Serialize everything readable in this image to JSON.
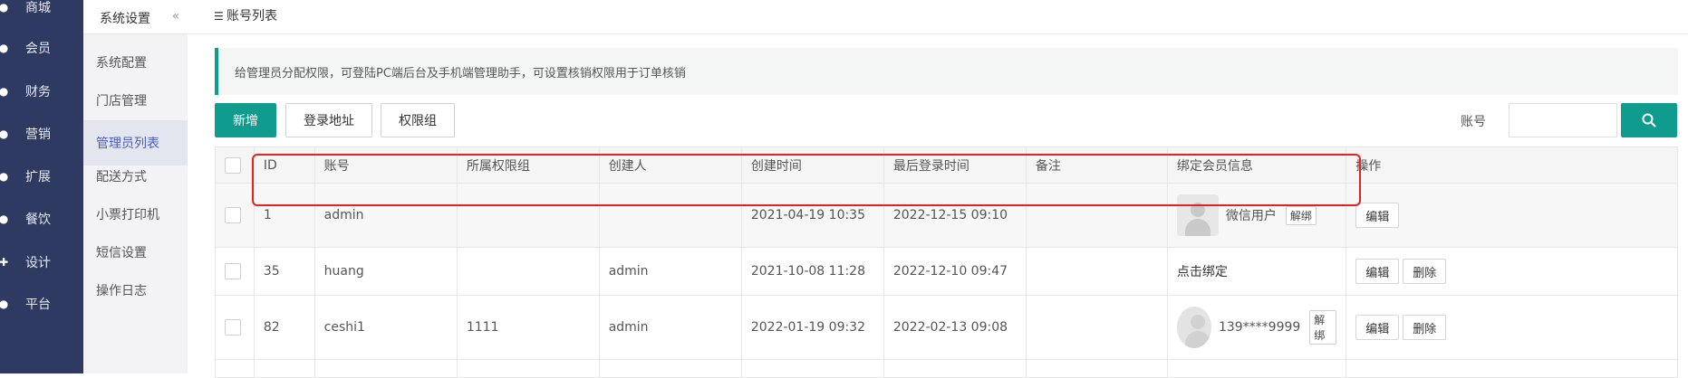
{
  "nav": {
    "items": [
      {
        "label": "商城"
      },
      {
        "label": "会员"
      },
      {
        "label": "财务"
      },
      {
        "label": "营销"
      },
      {
        "label": "扩展"
      },
      {
        "label": "餐饮"
      },
      {
        "label": "设计"
      },
      {
        "label": "平台"
      }
    ]
  },
  "subnav": {
    "title": "系统设置",
    "collapse": "«",
    "items": [
      {
        "label": "系统配置"
      },
      {
        "label": "门店管理"
      },
      {
        "label": "管理员列表"
      },
      {
        "label": "配送方式"
      },
      {
        "label": "小票打印机"
      },
      {
        "label": "短信设置"
      },
      {
        "label": "操作日志"
      }
    ]
  },
  "page": {
    "title": "账号列表",
    "notice": "给管理员分配权限，可登陆PC端后台及手机端管理助手，可设置核销权限用于订单核销"
  },
  "toolbar": {
    "add": "新增",
    "login_url": "登录地址",
    "role_group": "权限组",
    "search_label": "账号",
    "search_value": ""
  },
  "table": {
    "headers": [
      "ID",
      "账号",
      "所属权限组",
      "创建人",
      "创建时间",
      "最后登录时间",
      "备注",
      "绑定会员信息",
      "操作"
    ],
    "rows": [
      {
        "id": "1",
        "account": "admin",
        "group": "",
        "creator": "",
        "created": "2021-04-19 10:35",
        "last_login": "2022-12-15 09:10",
        "note": "",
        "member": "微信用户",
        "unbind": "解绑",
        "edit": "编辑"
      },
      {
        "id": "35",
        "account": "huang",
        "group": "",
        "creator": "admin",
        "created": "2021-10-08 11:28",
        "last_login": "2022-12-10 09:47",
        "note": "",
        "member": "点击绑定",
        "edit": "编辑",
        "delete": "删除"
      },
      {
        "id": "82",
        "account": "ceshi1",
        "group": "1111",
        "creator": "admin",
        "created": "2022-01-19 09:32",
        "last_login": "2022-02-13 09:08",
        "note": "",
        "member": "139****9999",
        "unbind": "解绑",
        "edit": "编辑",
        "delete": "删除"
      }
    ]
  },
  "colors": {
    "primary": "#0f9b8e",
    "nav_bg": "#2f3a62",
    "highlight": "#e0241e"
  },
  "icons": {
    "nav": [
      "store-icon",
      "member-icon",
      "finance-icon",
      "marketing-icon",
      "extend-icon",
      "food-icon",
      "design-icon",
      "platform-icon"
    ],
    "list": "list-icon",
    "search": "search-icon"
  }
}
